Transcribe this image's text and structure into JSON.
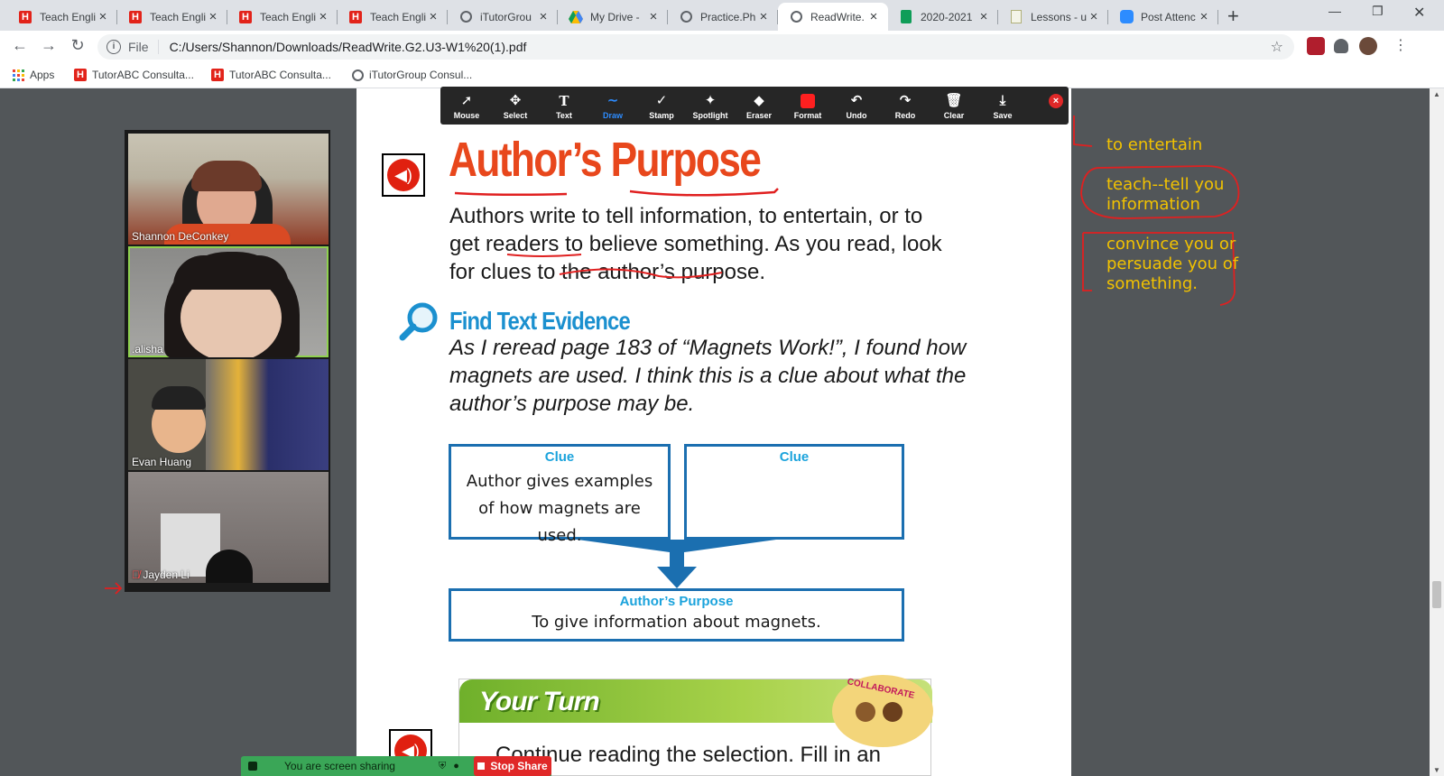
{
  "tabs": [
    {
      "title": "Teach Engli",
      "favicon": "h-icon"
    },
    {
      "title": "Teach Engli",
      "favicon": "h-icon"
    },
    {
      "title": "Teach Engli",
      "favicon": "h-icon"
    },
    {
      "title": "Teach Engli",
      "favicon": "h-icon"
    },
    {
      "title": "iTutorGrou",
      "favicon": "globe-icon"
    },
    {
      "title": "My Drive -",
      "favicon": "drive-icon"
    },
    {
      "title": "Practice.Ph",
      "favicon": "globe-icon"
    },
    {
      "title": "ReadWrite.",
      "favicon": "globe-icon",
      "active": true
    },
    {
      "title": "2020-2021",
      "favicon": "sheets-icon"
    },
    {
      "title": "Lessons - u",
      "favicon": "lesson-icon"
    },
    {
      "title": "Post Attenc",
      "favicon": "zoom-icon"
    }
  ],
  "address": {
    "scheme": "File",
    "url": "C:/Users/Shannon/Downloads/ReadWrite.G2.U3-W1%20(1).pdf"
  },
  "bookmarks": [
    {
      "label": "Apps",
      "icon": "apps-grid-icon"
    },
    {
      "label": "TutorABC Consulta...",
      "icon": "h-icon"
    },
    {
      "label": "TutorABC Consulta...",
      "icon": "h-icon"
    },
    {
      "label": "iTutorGroup Consul...",
      "icon": "globe-icon"
    }
  ],
  "annotate_tools": [
    {
      "label": "Mouse",
      "icon": "cursor-icon"
    },
    {
      "label": "Select",
      "icon": "move-icon"
    },
    {
      "label": "Text",
      "icon": "text-icon"
    },
    {
      "label": "Draw",
      "icon": "draw-icon",
      "active": true
    },
    {
      "label": "Stamp",
      "icon": "check-icon"
    },
    {
      "label": "Spotlight",
      "icon": "spotlight-icon"
    },
    {
      "label": "Eraser",
      "icon": "eraser-icon"
    },
    {
      "label": "Format",
      "icon": "format-icon"
    },
    {
      "label": "Undo",
      "icon": "undo-icon"
    },
    {
      "label": "Redo",
      "icon": "redo-icon"
    },
    {
      "label": "Clear",
      "icon": "trash-icon"
    },
    {
      "label": "Save",
      "icon": "save-icon"
    }
  ],
  "participants": [
    {
      "name": "Shannon DeConkey"
    },
    {
      "name": ".alisha",
      "active": true
    },
    {
      "name": "Evan Huang"
    },
    {
      "name": "Jayden Li",
      "muted": true
    }
  ],
  "page": {
    "title": "Author’s Purpose",
    "intro": "Authors write to tell information, to entertain, or to get readers to believe something. As you read, look for clues to the author’s purpose.",
    "section": "Find Text Evidence",
    "evidence": "As I reread page 183 of “Magnets Work!”, I found how magnets are used. I think this is a clue about what the author’s purpose may be.",
    "clue1_label": "Clue",
    "clue1_text": "Author gives examples of how magnets are used.",
    "clue2_label": "Clue",
    "clue2_text": "",
    "purpose_label": "Author’s Purpose",
    "purpose_text": "To give information about magnets.",
    "your_turn": "Your Turn",
    "your_turn_text": "Continue reading the selection. Fill in an",
    "collaborate": "COLLABORATE"
  },
  "annotations": {
    "a1": "to entertain",
    "a2": "teach--tell  you information",
    "a3": "convince you or persuade you of something."
  },
  "sharebar": {
    "status": "You are screen sharing",
    "stop": "Stop Share"
  },
  "colors": {
    "accent": "#2d8cff",
    "title": "#e8471c",
    "heading": "#1b90cf",
    "annotation": "#f2c200",
    "ink": "#e02020"
  }
}
